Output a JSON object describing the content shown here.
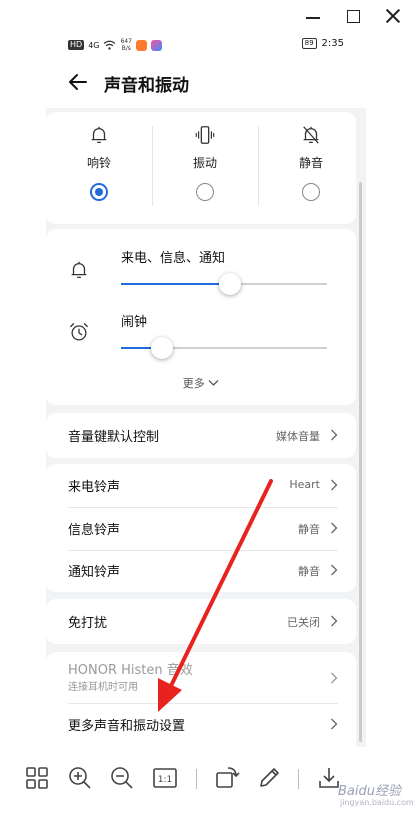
{
  "status_bar": {
    "hd": "HD",
    "signal": "4G",
    "net_speed_value": "647",
    "net_speed_unit": "B/s",
    "battery": "89",
    "time": "2:35"
  },
  "header": {
    "title": "声音和振动"
  },
  "modes": [
    {
      "label": "响铃",
      "selected": true
    },
    {
      "label": "振动",
      "selected": false
    },
    {
      "label": "静音",
      "selected": false
    }
  ],
  "volume": {
    "ringtone": {
      "label": "来电、信息、通知",
      "level": 0.53
    },
    "alarm": {
      "label": "闹钟",
      "level": 0.2
    },
    "more_label": "更多"
  },
  "rows": {
    "volume_key": {
      "label": "音量键默认控制",
      "value": "媒体音量"
    },
    "ringtone": {
      "label": "来电铃声",
      "value": "Heart"
    },
    "message": {
      "label": "信息铃声",
      "value": "静音"
    },
    "notification": {
      "label": "通知铃声",
      "value": "静音"
    },
    "dnd": {
      "label": "免打扰",
      "value": "已关闭"
    },
    "histen": {
      "label": "HONOR Histen 音效",
      "sub": "连接耳机时可用"
    },
    "more_settings": {
      "label": "更多声音和振动设置"
    }
  },
  "watermark": {
    "text": "Baidu经验",
    "sub": "jingyan.baidu.com"
  },
  "colors": {
    "accent": "#1f6cdc",
    "arrow": "#e8231f"
  }
}
